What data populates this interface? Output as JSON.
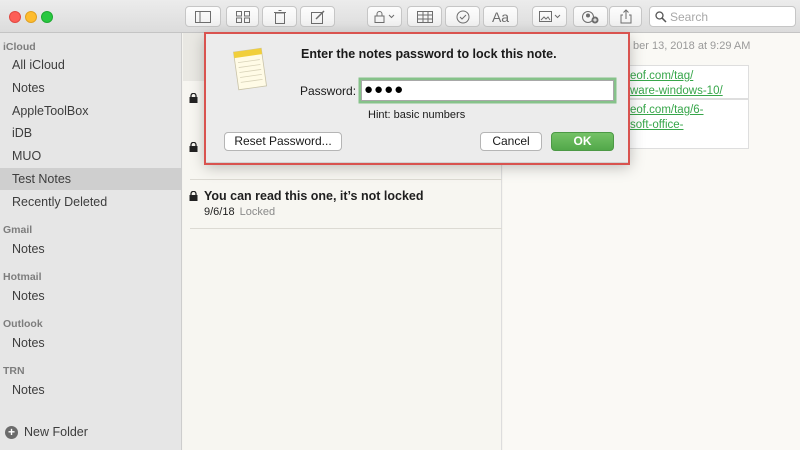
{
  "toolbar": {
    "buttons": [
      "sidebar-toggle",
      "grid-view",
      "trash",
      "compose",
      "lock",
      "table",
      "checklist",
      "format",
      "media",
      "add-people",
      "share"
    ],
    "format_label": "Aa",
    "search_placeholder": "Search"
  },
  "sidebar": {
    "accounts": [
      {
        "name": "iCloud",
        "folders": [
          "All iCloud",
          "Notes",
          "AppleToolBox",
          "iDB",
          "MUO",
          "Test Notes",
          "Recently Deleted"
        ]
      },
      {
        "name": "Gmail",
        "folders": [
          "Notes"
        ]
      },
      {
        "name": "Hotmail",
        "folders": [
          "Notes"
        ]
      },
      {
        "name": "Outlook",
        "folders": [
          "Notes"
        ]
      },
      {
        "name": "TRN",
        "folders": [
          "Notes"
        ]
      }
    ],
    "selected_folder": "Test Notes",
    "new_folder_label": "New Folder"
  },
  "notes_list": {
    "visible_note": {
      "title": "You can read this one, it’s not locked",
      "date": "9/6/18",
      "state": "Locked"
    }
  },
  "editor": {
    "date_fragment": "ber 13, 2018 at 9:29 AM",
    "link1": [
      "eof.com/tag/",
      "ware-windows-10/"
    ],
    "link2": [
      "eof.com/tag/6-",
      "soft-office-"
    ]
  },
  "dialog": {
    "title": "Enter the notes password to lock this note.",
    "password_label": "Password:",
    "password_value": "●●●●",
    "hint": "Hint: basic numbers",
    "reset_label": "Reset Password...",
    "cancel_label": "Cancel",
    "ok_label": "OK"
  },
  "colors": {
    "accent_green": "#52a84a",
    "link_green": "#37a64a",
    "highlight_red": "#d9534f"
  }
}
